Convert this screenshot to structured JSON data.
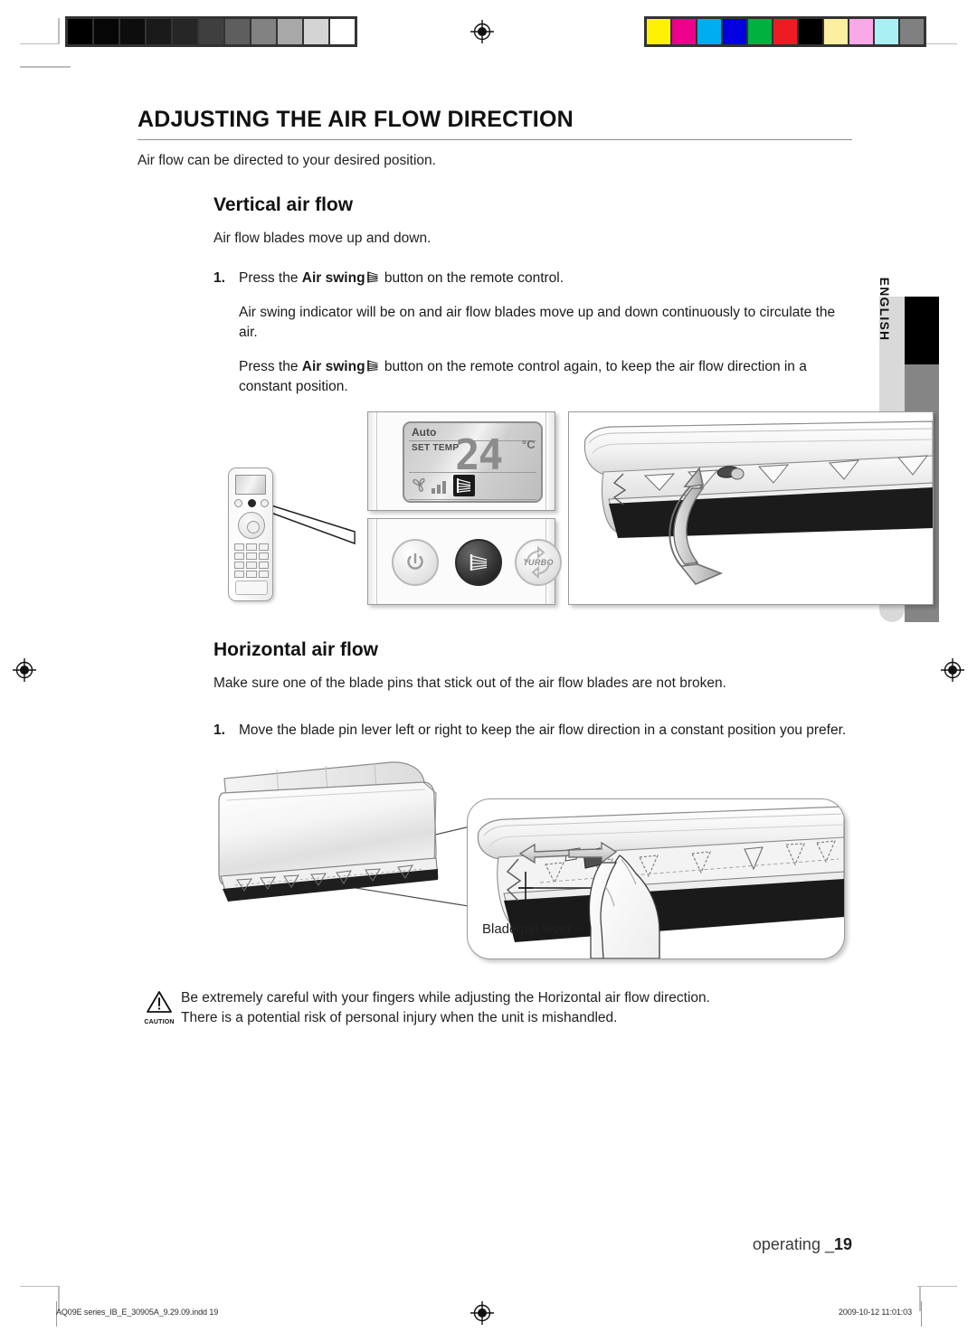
{
  "document": {
    "title": "ADJUSTING THE AIR FLOW DIRECTION",
    "lead": "Air flow can be directed to your desired position.",
    "side_tab": "ENGLISH",
    "page_footer": "operating _",
    "page_number": "19"
  },
  "vertical_section": {
    "heading": "Vertical air flow",
    "intro": "Air flow blades move up and down.",
    "step_number": "1.",
    "step_prefix": "Press the ",
    "step_bold": "Air swing",
    "step_suffix": " button on the remote control.",
    "para1": "Air swing indicator will be on and air flow blades move up and down continuously to circulate the air.",
    "para2_prefix": "Press the ",
    "para2_bold": "Air swing",
    "para2_suffix": " button on the remote control again, to keep the air flow direction in a constant position."
  },
  "remote": {
    "lcd_mode": "Auto",
    "lcd_set_temp_label": "SET TEMP",
    "lcd_temperature": "24",
    "lcd_unit": "°C",
    "button_power": "power-button",
    "button_air_swing": "air-swing-button",
    "button_turbo": "TURBO"
  },
  "horizontal_section": {
    "heading": "Horizontal air flow",
    "intro": "Make sure one of the blade pins that stick out of the air flow blades are not broken.",
    "step_number": "1.",
    "step_text": "Move the blade pin lever left or right to keep the air flow direction in a constant position you prefer.",
    "figure_label": "Blade pin lever"
  },
  "caution": {
    "label": "CAUTION",
    "line1": "Be extremely careful with your fingers while adjusting the Horizontal air flow direction.",
    "line2": "There is a potential risk of personal injury when the unit is mishandled."
  },
  "print_footer": {
    "filename": "AQ09E series_IB_E_30905A_9.29.09.indd   19",
    "timestamp": "2009-10-12   11:01:03"
  },
  "print_marks": {
    "grayscale_patches": [
      "#000000",
      "#060606",
      "#0d0d0d",
      "#1a1a1a",
      "#262626",
      "#3f3f3f",
      "#5e5e5e",
      "#828282",
      "#a8a8a8",
      "#d4d4d4",
      "#ffffff"
    ],
    "color_patches": [
      "#fff200",
      "#ec008c",
      "#00aeef",
      "#0000e0",
      "#00b140",
      "#ed1c24",
      "#000000",
      "#fcf0a0",
      "#f9a8e8",
      "#a8f0f4",
      "#808080"
    ]
  }
}
